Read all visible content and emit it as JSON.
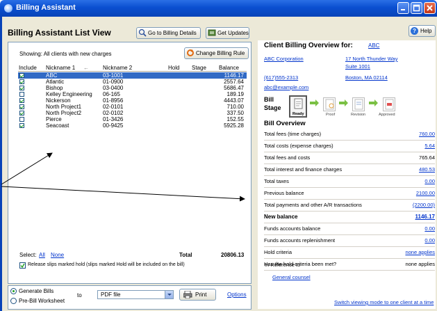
{
  "window": {
    "title": "Billing Assistant"
  },
  "toolbar": {
    "heading": "Billing Assistant List View",
    "goto_label": "Go to Billing Details",
    "updates_label": "Get Updates",
    "help_label": "Help"
  },
  "list": {
    "showing": "Showing:  All clients with new charges",
    "change_rule_label": "Change Billing Rule",
    "columns": [
      "Include",
      "Nickname 1",
      "Nickname 2",
      "Hold",
      "Stage",
      "Balance"
    ],
    "rows": [
      {
        "n1": "ABC",
        "n2": "03-1001",
        "bal": "1146.17",
        "checked": true,
        "selected": true
      },
      {
        "n1": "Atlantic",
        "n2": "01-0900",
        "bal": "2557.64",
        "checked": true
      },
      {
        "n1": "Bishop",
        "n2": "03-0400",
        "bal": "5686.47",
        "checked": true
      },
      {
        "n1": "Kelley Engineering",
        "n2": "06-165",
        "bal": "189.19",
        "checked": false
      },
      {
        "n1": "Nickerson",
        "n2": "01-8956",
        "bal": "4443.07",
        "checked": true
      },
      {
        "n1": "North Project1",
        "n2": "02-0101",
        "bal": "710.00",
        "checked": true
      },
      {
        "n1": "North Project2",
        "n2": "02-0102",
        "bal": "337.50",
        "checked": true
      },
      {
        "n1": "Pierce",
        "n2": "01-3426",
        "bal": "152.55",
        "checked": false
      },
      {
        "n1": "Seacoast",
        "n2": "00-9425",
        "bal": "5925.28",
        "checked": true
      }
    ],
    "select_label": "Select:",
    "all_label": "All",
    "none_label": "None",
    "total_label": "Total",
    "total_value": "20806.13",
    "release_label": "Release slips marked hold (slips marked Hold will be included on the bill)"
  },
  "output": {
    "generate_label": "Generate Bills",
    "prebill_label": "Pre-Bill Worksheet",
    "to_label": "to",
    "format_value": "PDF file",
    "print_label": "Print",
    "options_label": "Options"
  },
  "overview": {
    "title": "Client Billing Overview for:",
    "client_link": "ABC",
    "company": "ABC Corporation",
    "address1": "17 North Thunder Way",
    "address2": "Suite 1001",
    "city": "Boston, MA 02114",
    "phone": "(617)555-2313",
    "email": "abc@example.com",
    "bill_stage_label1": "Bill",
    "bill_stage_label2": "Stage",
    "stages": [
      "Ready",
      "Proof",
      "Revision",
      "Approved"
    ],
    "section_title": "Bill Overview",
    "rows": [
      {
        "label": "Total fees (time charges)",
        "value": "760.00",
        "link": true
      },
      {
        "label": "Total costs (expense charges)",
        "value": "5.64",
        "link": true
      },
      {
        "label": "Total fees and costs",
        "value": "765.64",
        "link": false
      },
      {
        "label": "Total interest and finance charges",
        "value": "480.53",
        "link": true
      },
      {
        "label": "Total taxes",
        "value": "0.00",
        "link": true
      },
      {
        "label": "Previous balance",
        "value": "2100.00",
        "link": true
      },
      {
        "label": "Total payments and other A/R transactions",
        "value": "(2200.00)",
        "link": true
      },
      {
        "label": "New balance",
        "value": "1146.17",
        "link": true,
        "bold": true
      },
      {
        "label": "Funds accounts balance",
        "value": "0.00",
        "link": true
      },
      {
        "label": "Funds accounts replenishment",
        "value": "0.00",
        "link": true
      },
      {
        "label": "Hold criteria",
        "value": "none applies",
        "link": true
      },
      {
        "label": "Has the hold criteria been met?",
        "value": "none applies",
        "link": false
      }
    ],
    "in_reference_label": "In Reference to",
    "in_reference_value": "General counsel",
    "switch_link": "Switch viewing mode to one client at a time"
  }
}
